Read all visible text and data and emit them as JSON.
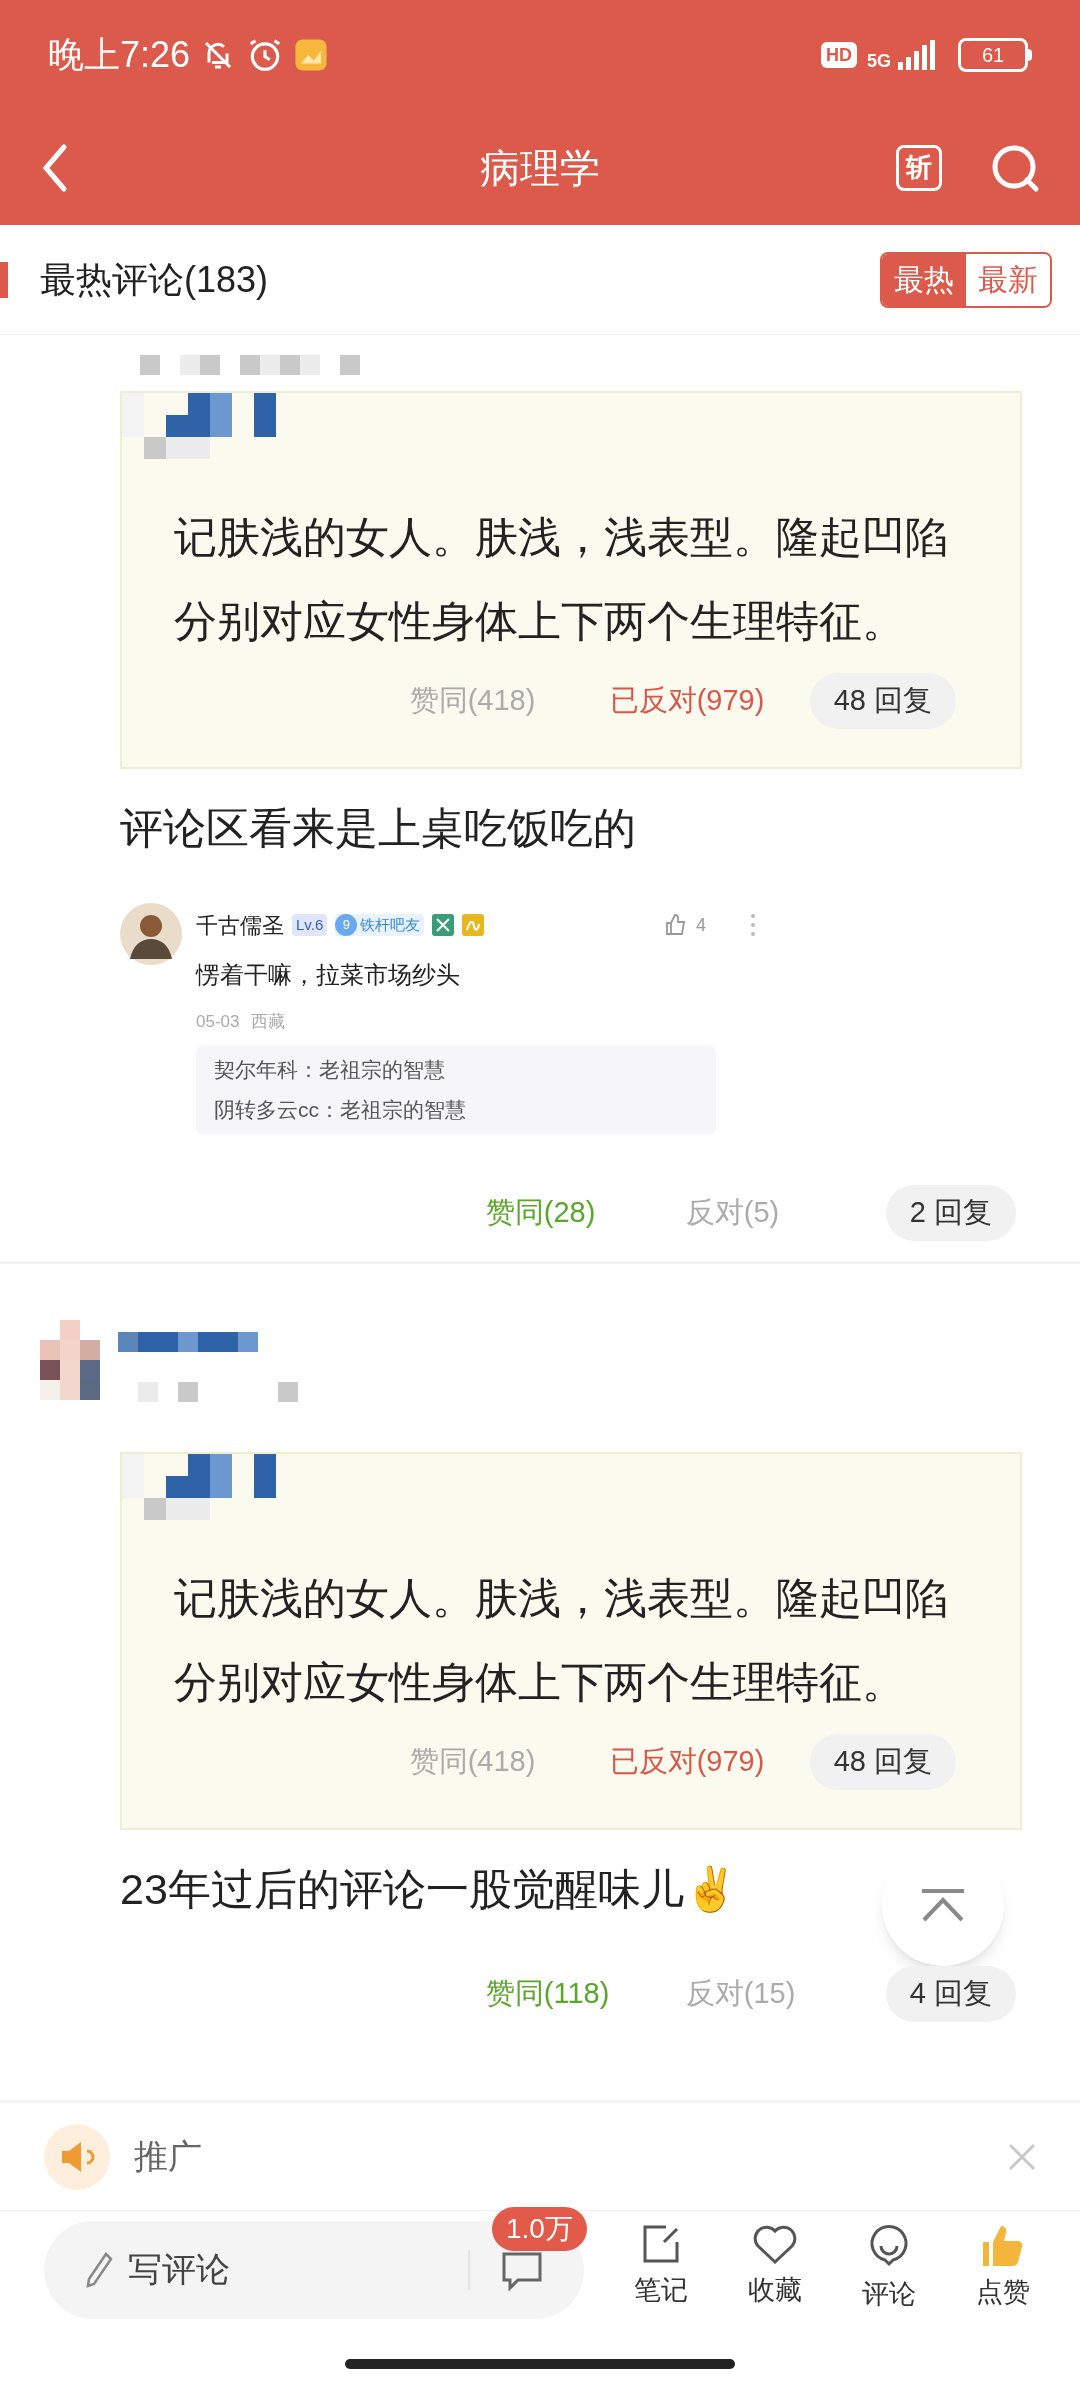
{
  "status_bar": {
    "time": "晚上7:26",
    "hd": "HD",
    "network": "5G",
    "battery": "61"
  },
  "header": {
    "title": "病理学",
    "badge": "斩"
  },
  "comments_header": {
    "title": "最热评论(183)",
    "sort_tabs": [
      {
        "label": "最热",
        "selected": true
      },
      {
        "label": "最新",
        "selected": false
      }
    ]
  },
  "comments": [
    {
      "quote": {
        "text": "记肤浅的女人。肤浅，浅表型。隆起凹陷分别对应女性身体上下两个生理特征。",
        "agree": {
          "label": "赞同(418)",
          "selected": false
        },
        "oppose": {
          "label": "已反对(979)",
          "selected": true
        },
        "replies": "48 回复"
      },
      "text": "评论区看来是上桌吃饭吃的",
      "embed": {
        "author": "千古儒圣",
        "level": "Lv.6",
        "fan_badge": {
          "number": "9",
          "label": "铁杆吧友"
        },
        "likes": "4",
        "text": "愣着干嘛，拉菜市场纱头",
        "date": "05-03",
        "location": "西藏",
        "replies": [
          "契尔年科：老祖宗的智慧",
          "阴转多云cc：老祖宗的智慧"
        ]
      },
      "agree": {
        "label": "赞同(28)",
        "selected": true
      },
      "oppose": {
        "label": "反对(5)",
        "selected": false
      },
      "replies": "2 回复"
    },
    {
      "quote": {
        "text": "记肤浅的女人。肤浅，浅表型。隆起凹陷分别对应女性身体上下两个生理特征。",
        "agree": {
          "label": "赞同(418)",
          "selected": false
        },
        "oppose": {
          "label": "已反对(979)",
          "selected": true
        },
        "replies": "48 回复"
      },
      "text": "23年过后的评论一股觉醒味儿✌",
      "agree": {
        "label": "赞同(118)",
        "selected": true
      },
      "oppose": {
        "label": "反对(15)",
        "selected": false
      },
      "replies": "4 回复"
    }
  ],
  "promo": {
    "label": "推广"
  },
  "bottom_bar": {
    "placeholder": "写评论",
    "comment_count": "1.0万",
    "actions": [
      {
        "kind": "note",
        "label": "笔记",
        "selected": false
      },
      {
        "kind": "favorite",
        "label": "收藏",
        "selected": false
      },
      {
        "kind": "comment",
        "label": "评论",
        "selected": false
      },
      {
        "kind": "like",
        "label": "点赞",
        "selected": true
      }
    ]
  }
}
